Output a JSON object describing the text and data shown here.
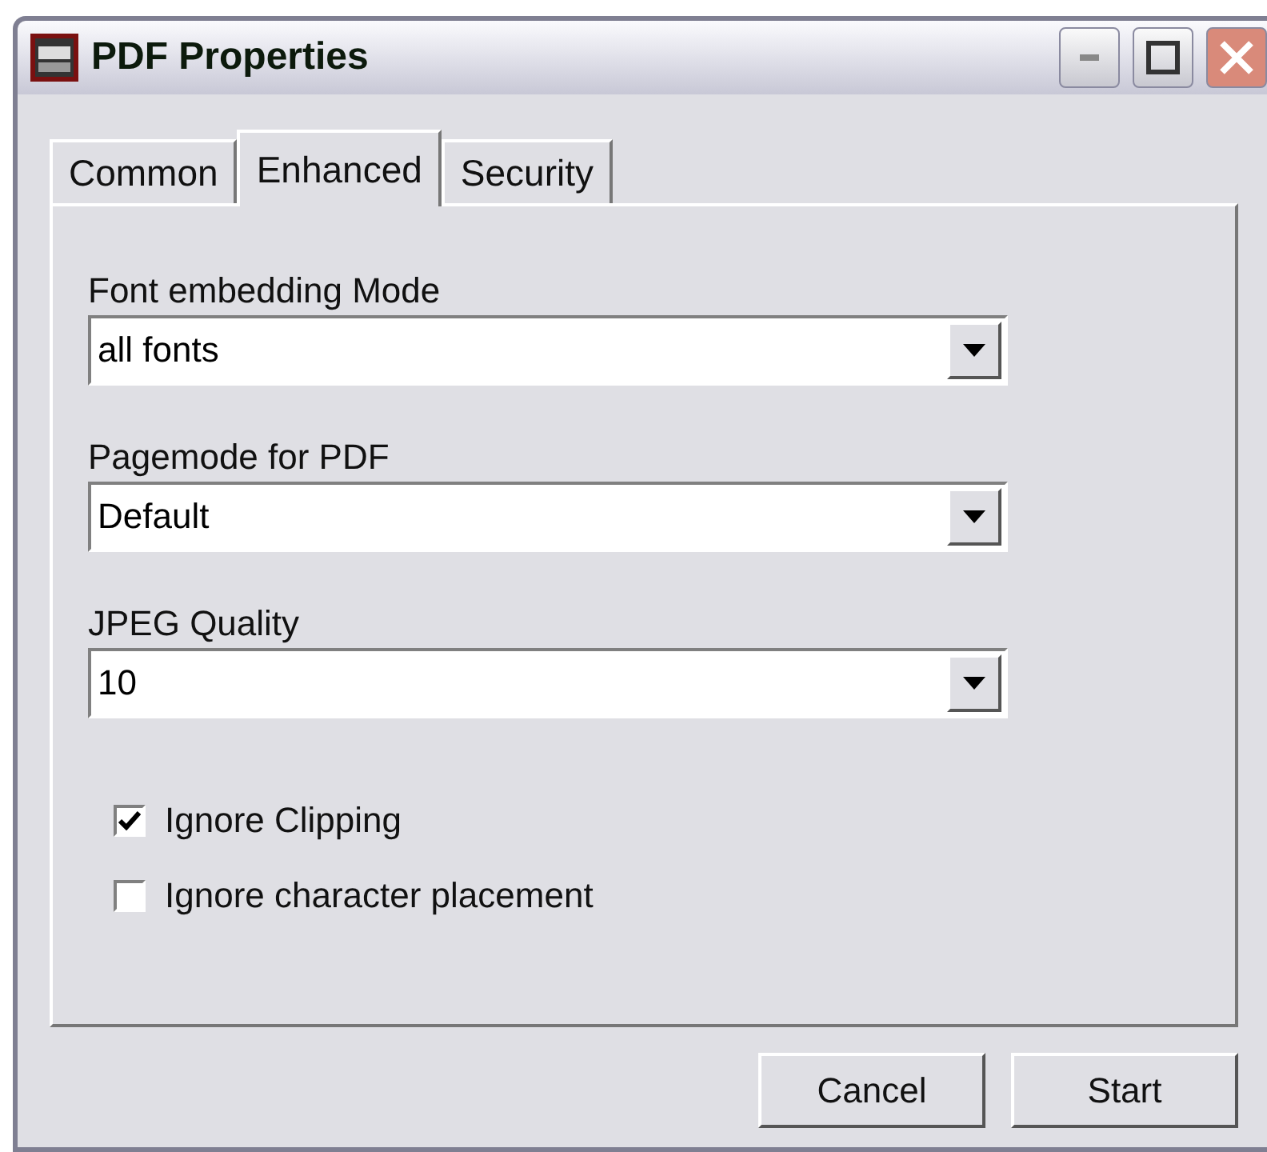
{
  "window": {
    "title": "PDF Properties"
  },
  "tabs": [
    {
      "label": "Common",
      "selected": false
    },
    {
      "label": "Enhanced",
      "selected": true
    },
    {
      "label": "Security",
      "selected": false
    }
  ],
  "fields": [
    {
      "label": "Font embedding Mode",
      "value": "all fonts"
    },
    {
      "label": "Pagemode for PDF",
      "value": "Default"
    },
    {
      "label": "JPEG Quality",
      "value": "10"
    }
  ],
  "checkboxes": [
    {
      "label": "Ignore Clipping",
      "checked": true
    },
    {
      "label": "Ignore character placement",
      "checked": false
    }
  ],
  "buttons": [
    "Cancel",
    "Start"
  ]
}
